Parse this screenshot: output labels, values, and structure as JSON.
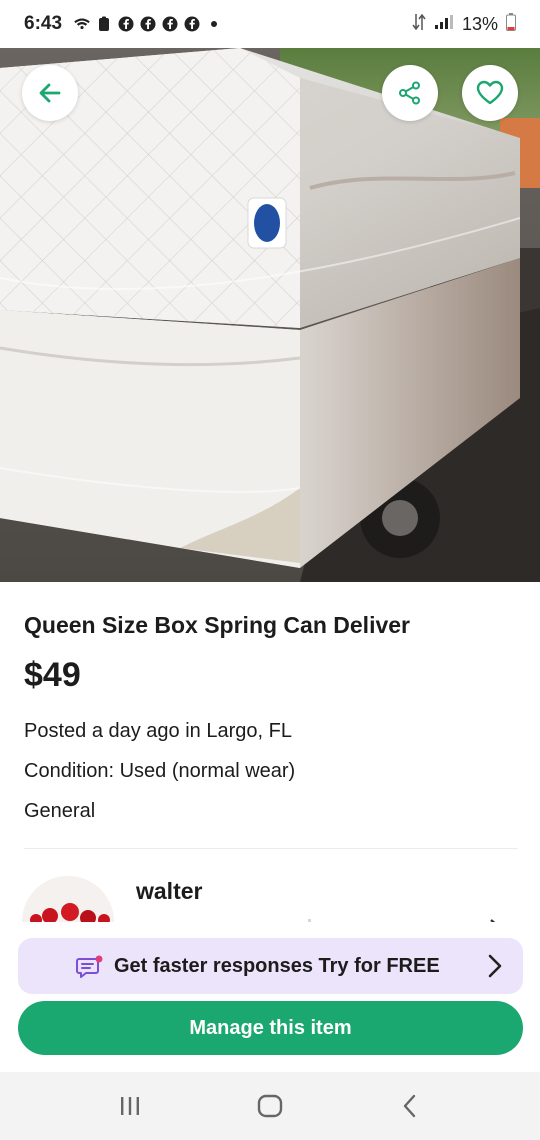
{
  "status_bar": {
    "time": "6:43",
    "battery": "13%"
  },
  "listing": {
    "title": "Queen Size Box Spring Can Deliver",
    "price": "$49",
    "posted": "Posted a day ago in Largo, FL",
    "condition": "Condition: Used (normal wear)",
    "category": "General"
  },
  "seller": {
    "name": "walter"
  },
  "promo": {
    "text": "Get faster responses Try for FREE"
  },
  "actions": {
    "manage_label": "Manage this item"
  },
  "icons": {
    "back": "arrow-left-icon",
    "share": "share-icon",
    "favorite": "heart-icon",
    "promo": "chat-sparkle-icon",
    "nav_recents": "recents-icon",
    "nav_home": "home-icon",
    "nav_back": "back-icon"
  },
  "colors": {
    "accent_green": "#1aa770",
    "promo_bg": "#ece4fb",
    "promo_icon": "#7b4fd8"
  }
}
